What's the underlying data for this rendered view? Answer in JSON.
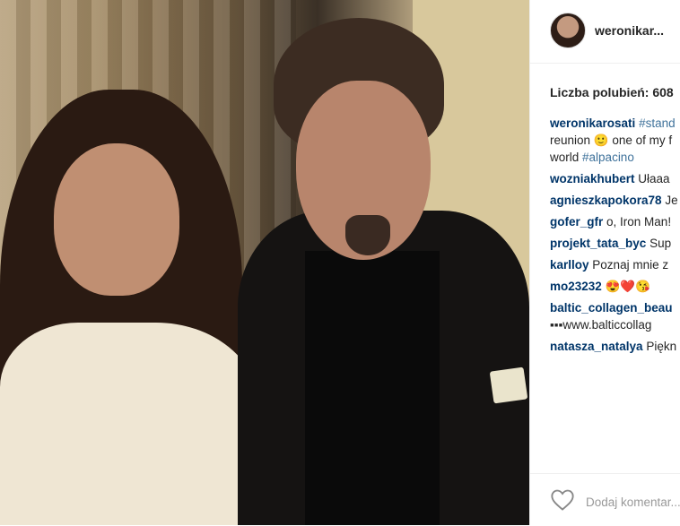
{
  "post": {
    "username": "weronikar...",
    "likes_text": "Liczba polubień: 608",
    "caption": {
      "author": "weronikarosati",
      "line1_tag": "#stand",
      "line2": "reunion 🙂 one of my f",
      "line3_text": "world",
      "line3_tag": "#alpacino"
    },
    "comments": [
      {
        "user": "wozniakhubert",
        "text": "Ułaaa"
      },
      {
        "user": "agnieszkapokora78",
        "text": "Je"
      },
      {
        "user": "gofer_gfr",
        "text": "o, Iron Man!"
      },
      {
        "user": "projekt_tata_byc",
        "text": "Sup"
      },
      {
        "user": "karlloy",
        "text": "Poznaj mnie z"
      },
      {
        "user": "mo23232",
        "text": "😍❤️😘"
      },
      {
        "user": "baltic_collagen_beau",
        "text": ""
      },
      {
        "user": "",
        "text": "▪▪▪www.balticcollag"
      },
      {
        "user": "natasza_natalya",
        "text": "Piękn"
      }
    ],
    "add_comment_placeholder": "Dodaj komentar..."
  },
  "icons": {
    "like": "heart-icon",
    "avatar": "avatar"
  }
}
